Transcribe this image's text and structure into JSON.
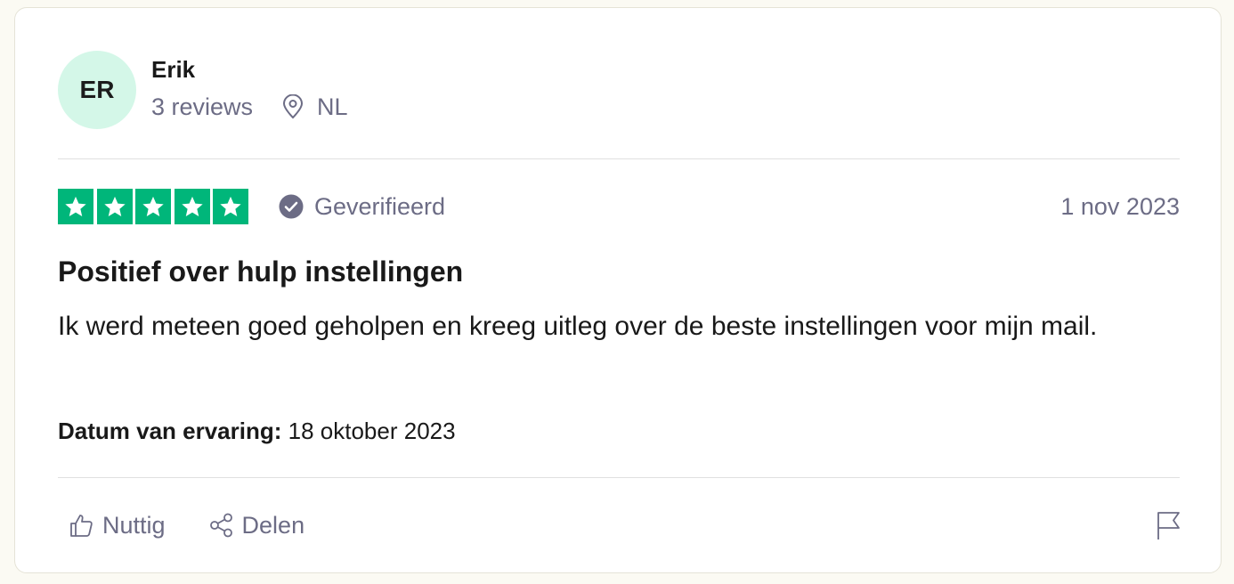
{
  "review": {
    "consumer": {
      "initials": "ER",
      "name": "Erik",
      "reviews_count": "3 reviews",
      "country": "NL"
    },
    "rating": 5,
    "verified_label": "Geverifieerd",
    "date": "1 nov 2023",
    "title": "Positief over hulp instellingen",
    "body": "Ik werd meteen goed geholpen en kreeg uitleg over de beste instellingen voor mijn mail.",
    "experience_label": "Datum van ervaring:",
    "experience_date": "18 oktober 2023"
  },
  "actions": {
    "useful_label": "Nuttig",
    "share_label": "Delen"
  },
  "colors": {
    "star_green": "#00b67a",
    "avatar_bg": "#d4f7e8",
    "muted_text": "#6c6c85"
  },
  "icons": [
    "location-pin-icon",
    "star-icon",
    "verified-check-icon",
    "thumbs-up-icon",
    "share-icon",
    "flag-icon"
  ]
}
